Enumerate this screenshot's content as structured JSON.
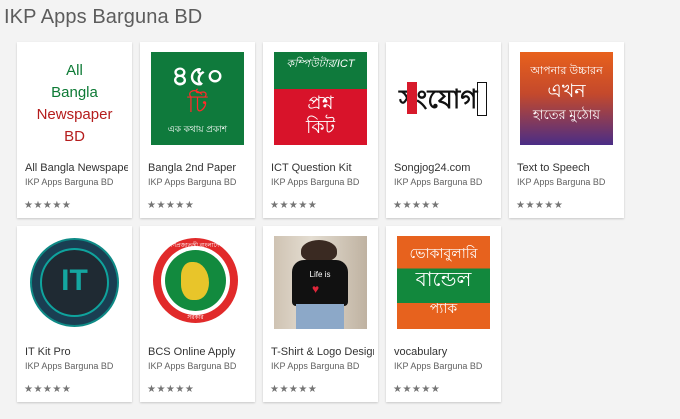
{
  "developer_title": "IKP Apps Barguna BD",
  "rating_glyphs": "★★★★★",
  "apps": [
    {
      "name": "All Bangla Newspaper",
      "developer": "IKP Apps Barguna BD",
      "icon": "all-bangla-newspaper-icon",
      "icon_text": [
        "All",
        "Bangla",
        "Newspaper",
        "BD"
      ]
    },
    {
      "name": "Bangla 2nd Paper",
      "developer": "IKP Apps Barguna BD",
      "icon": "bangla-2nd-paper-icon",
      "icon_text": [
        "৪৫০",
        "টি",
        "এক কথায় প্রকাশ"
      ]
    },
    {
      "name": "ICT Question Kit",
      "developer": "IKP Apps Barguna BD",
      "icon": "ict-question-kit-icon",
      "icon_text": [
        "কম্পিউটার/ICT",
        "প্রশ্ন",
        "কিট"
      ]
    },
    {
      "name": "Songjog24.com",
      "developer": "IKP Apps Barguna BD",
      "icon": "songjog24-icon",
      "icon_text": [
        "সংযোগ"
      ]
    },
    {
      "name": "Text to Speech",
      "developer": "IKP Apps Barguna BD",
      "icon": "text-to-speech-icon",
      "icon_text": [
        "আপনার উচ্চারন",
        "এখন",
        "হাতের মুঠোয়"
      ]
    },
    {
      "name": "IT Kit Pro",
      "developer": "IKP Apps Barguna BD",
      "icon": "it-kit-pro-icon",
      "icon_text": [
        "IT"
      ]
    },
    {
      "name": "BCS Online Apply",
      "developer": "IKP Apps Barguna BD",
      "icon": "bcs-online-apply-icon",
      "icon_text": [
        "গণপ্রজাতন্ত্রী বাংলাদেশ",
        "সরকার"
      ]
    },
    {
      "name": "T-Shirt & Logo Design",
      "developer": "IKP Apps Barguna BD",
      "icon": "tshirt-logo-design-icon",
      "icon_text": [
        "Life is"
      ]
    },
    {
      "name": "vocabulary",
      "developer": "IKP Apps Barguna BD",
      "icon": "vocabulary-icon",
      "icon_text": [
        "ভোকাবুলারি",
        "বান্ডেল",
        "প্যাক"
      ]
    }
  ],
  "colors": {
    "page_bg": "#f3f3f3",
    "card_bg": "#ffffff",
    "green": "#10713f",
    "red": "#d9142b",
    "orange": "#e7621e",
    "purple": "#4b2d83",
    "teal": "#0e8a86"
  }
}
